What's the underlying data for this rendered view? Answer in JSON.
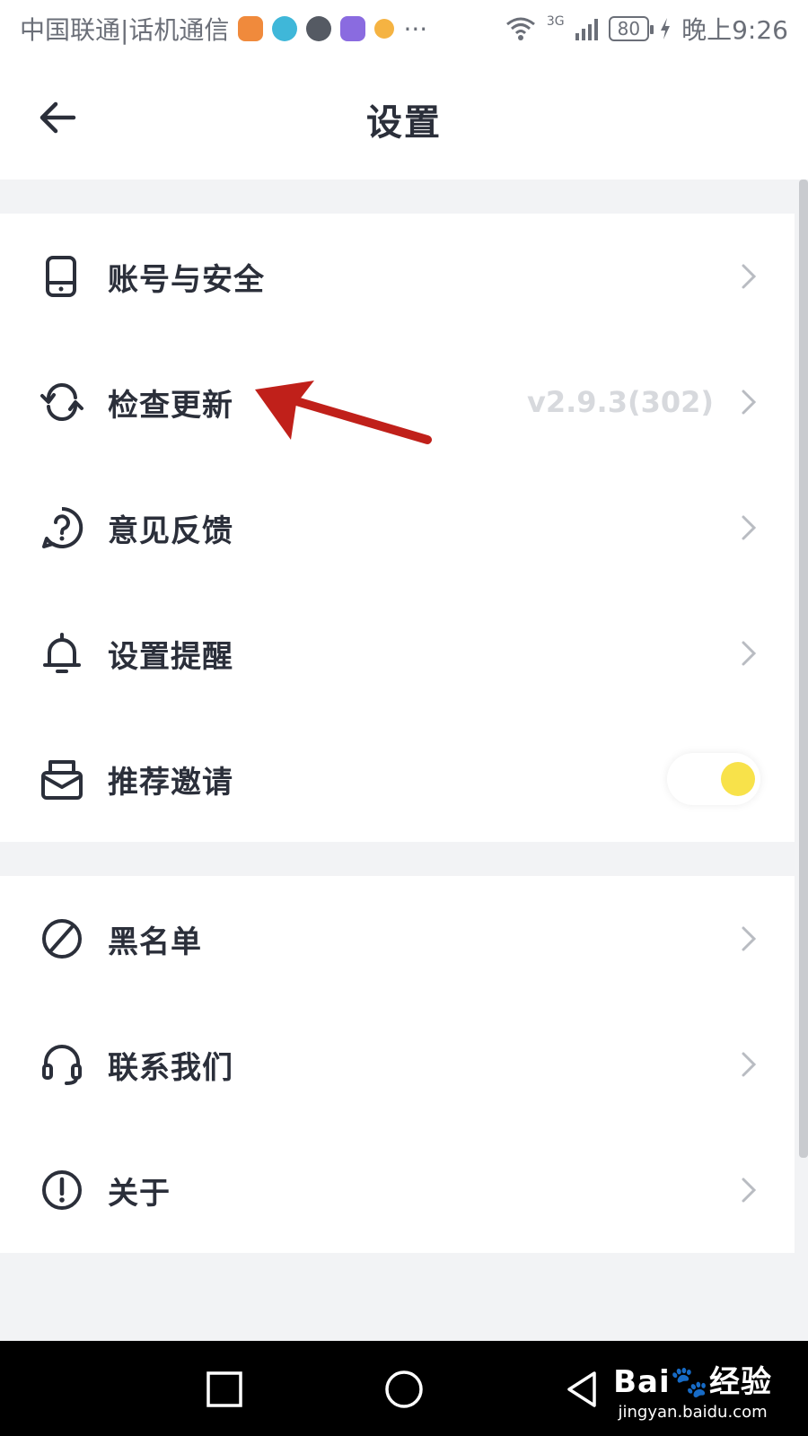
{
  "status_bar": {
    "carrier": "中国联通|话机通信",
    "more": "···",
    "network": "3G",
    "battery": "80",
    "time": "晚上9:26",
    "app_icon_colors": [
      "#f08a3c",
      "#3fb7d9",
      "#555a63",
      "#8a6be0",
      "#f5b342"
    ]
  },
  "header": {
    "title": "设置",
    "back_icon": "arrow-left-icon"
  },
  "settings": {
    "group1": [
      {
        "label": "账号与安全",
        "icon": "phone-icon",
        "control": "chevron"
      },
      {
        "label": "检查更新",
        "icon": "refresh-icon",
        "control": "chevron",
        "value": "v2.9.3(302)"
      },
      {
        "label": "意见反馈",
        "icon": "help-icon",
        "control": "chevron"
      },
      {
        "label": "设置提醒",
        "icon": "bell-icon",
        "control": "chevron"
      },
      {
        "label": "推荐邀请",
        "icon": "mail-icon",
        "control": "toggle",
        "toggle_on": true
      }
    ],
    "group2": [
      {
        "label": "黑名单",
        "icon": "block-icon",
        "control": "chevron"
      },
      {
        "label": "联系我们",
        "icon": "headset-icon",
        "control": "chevron"
      },
      {
        "label": "关于",
        "icon": "info-icon",
        "control": "chevron"
      }
    ]
  },
  "colors": {
    "accent_toggle": "#f8e24a",
    "annotation_arrow": "#c0201a",
    "text": "#2b2f3a",
    "version_text": "#d7d9dd"
  },
  "watermark": {
    "brand": "Bai🐾经验",
    "url": "jingyan.baidu.com"
  }
}
